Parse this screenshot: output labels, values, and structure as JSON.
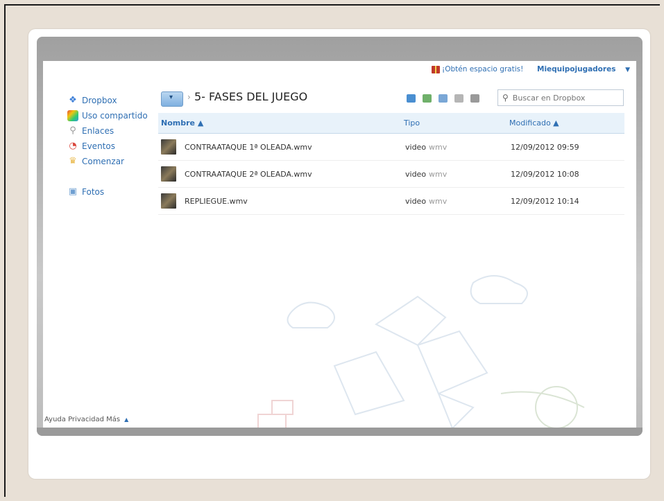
{
  "topbar": {
    "promo_label": "¡Obtén espacio gratis!",
    "user_label": "Miequipojugadores",
    "user_caret": "▼"
  },
  "sidebar": {
    "items": [
      {
        "label": "Dropbox",
        "icon": "dropbox-icon",
        "color": "#3d7fd8"
      },
      {
        "label": "Uso compartido",
        "icon": "rainbow-icon",
        "color": "#e8a030"
      },
      {
        "label": "Enlaces",
        "icon": "paperclip-icon",
        "color": "#999999"
      },
      {
        "label": "Eventos",
        "icon": "clock-icon",
        "color": "#d9443a"
      },
      {
        "label": "Comenzar",
        "icon": "cake-icon",
        "color": "#e9b84a"
      },
      {
        "label": "Fotos",
        "icon": "photo-icon",
        "color": "#6e9fd1"
      }
    ]
  },
  "header": {
    "separator": "›",
    "folder_title": "5- FASES DEL JUEGO",
    "search_placeholder": "Buscar en Dropbox"
  },
  "table": {
    "columns": {
      "name": "Nombre ▲",
      "type": "Tipo",
      "modified": "Modificado ▲"
    },
    "rows": [
      {
        "name": "CONTRAATAQUE 1ª OLEADA.wmv",
        "type": "video",
        "ext": "wmv",
        "modified": "12/09/2012 09:59"
      },
      {
        "name": "CONTRAATAQUE 2ª OLEADA.wmv",
        "type": "video",
        "ext": "wmv",
        "modified": "12/09/2012 10:08"
      },
      {
        "name": "REPLIEGUE.wmv",
        "type": "video",
        "ext": "wmv",
        "modified": "12/09/2012 10:14"
      }
    ]
  },
  "footer": {
    "label": "Ayuda Privacidad Más",
    "up": "▲"
  },
  "colors": {
    "link": "#2f6fb3",
    "header_bg": "#e8f2fa",
    "page_bg": "#e8e0d6"
  }
}
